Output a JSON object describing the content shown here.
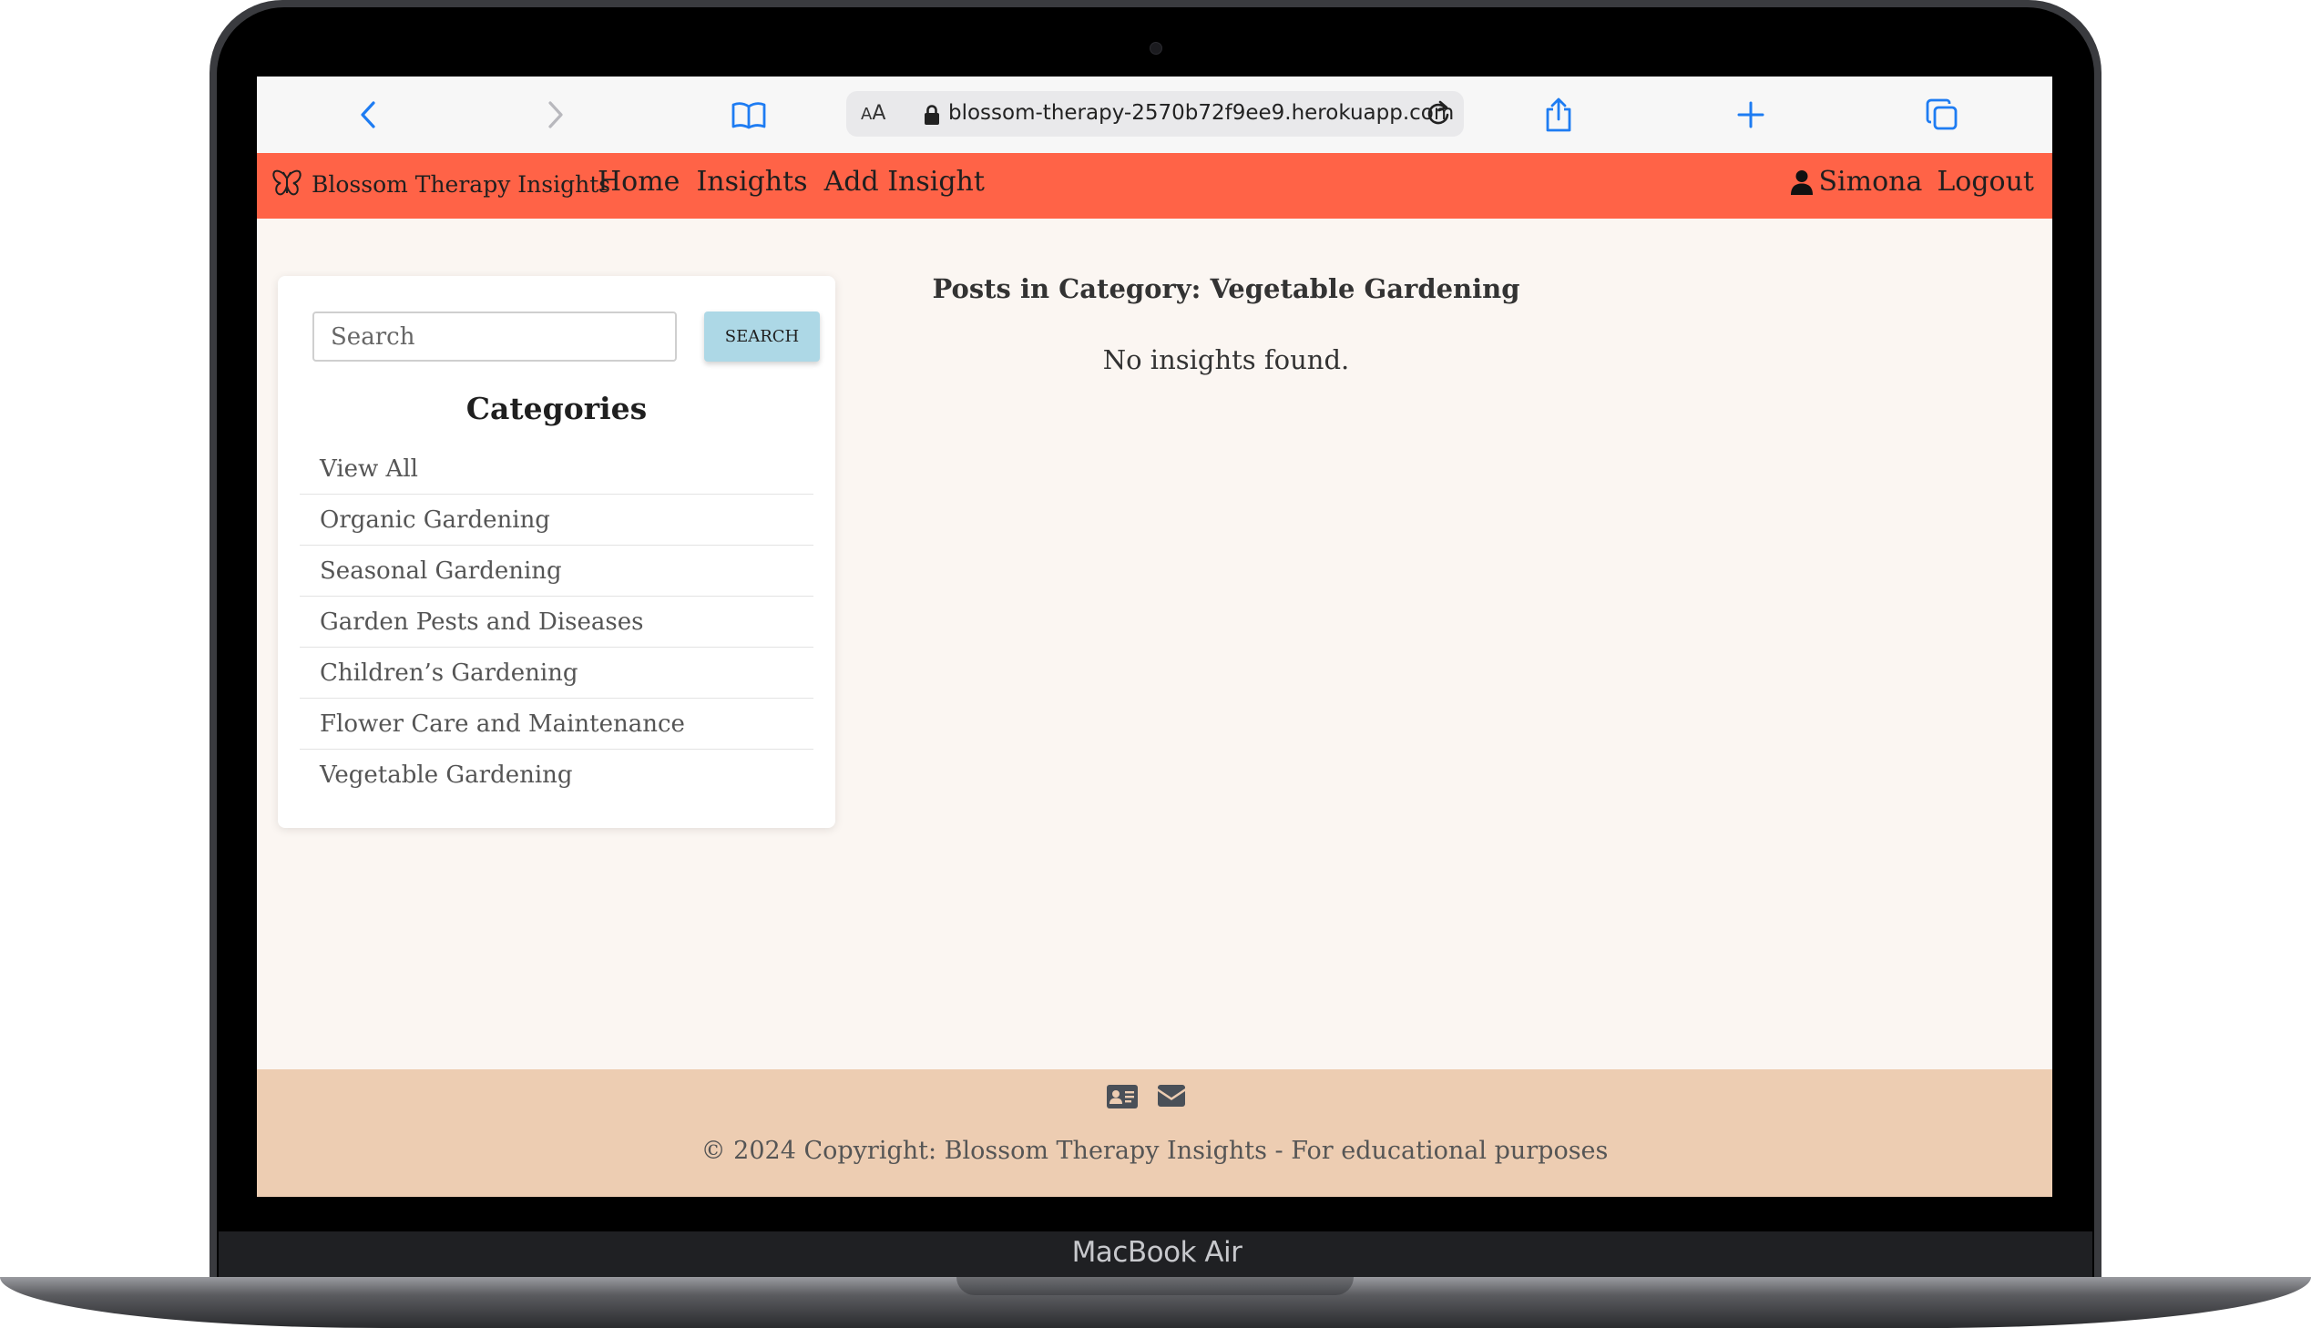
{
  "device": {
    "model_label": "MacBook Air"
  },
  "browser": {
    "text_size_label_small": "A",
    "text_size_label_big": "A",
    "url": "blossom-therapy-2570b72f9ee9.herokuapp.com",
    "icons": [
      "back-icon",
      "forward-icon",
      "bookmarks-icon",
      "lock-icon",
      "reload-icon",
      "share-icon",
      "new-tab-icon",
      "tabs-icon"
    ]
  },
  "navbar": {
    "brand": "Blossom Therapy Insights",
    "brand_icon": "butterfly-icon",
    "links": [
      "Home",
      "Insights",
      "Add Insight"
    ],
    "user_name": "Simona",
    "user_icon": "user-icon",
    "logout": "Logout",
    "color": "#ff6347"
  },
  "sidebar": {
    "search_placeholder": "Search",
    "search_button": "SEARCH",
    "categories_title": "Categories",
    "categories": [
      "View All",
      "Organic Gardening",
      "Seasonal Gardening",
      "Garden Pests and Diseases",
      "Children’s Gardening",
      "Flower Care and Maintenance",
      "Vegetable Gardening"
    ]
  },
  "main": {
    "title": "Posts in Category: Vegetable Gardening",
    "empty_message": "No insights found."
  },
  "footer": {
    "icons": [
      "contact-card-icon",
      "envelope-icon"
    ],
    "copyright": "© 2024 Copyright: Blossom Therapy Insights - For educational purposes",
    "color": "#edcdb2"
  }
}
